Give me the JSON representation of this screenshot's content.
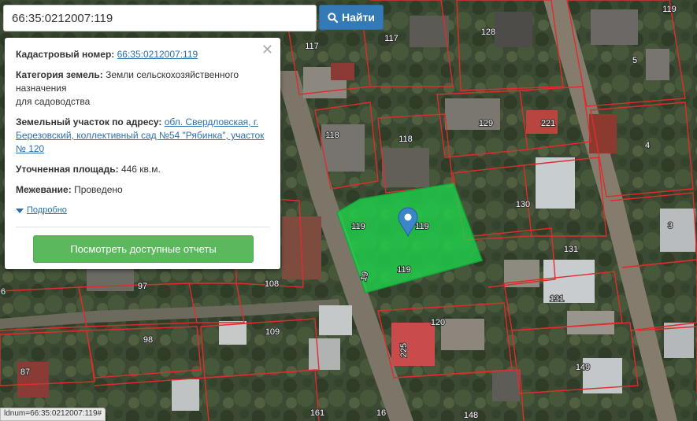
{
  "search": {
    "value": "66:35:0212007:119",
    "button_label": "Найти"
  },
  "popup": {
    "cadastral_label": "Кадастровый номер:",
    "cadastral_value": "66:35:0212007:119",
    "category_label": "Категория земель:",
    "category_value": "Земли сельскохозяйственного назначения",
    "category_use": "для садоводства",
    "address_label": "Земельный участок по адресу:",
    "address_value": "обл. Свердловская, г. Березовский, коллективный сад №54 \"Рябинка\", участок № 120",
    "area_label": "Уточненная площадь:",
    "area_value": "446 кв.м.",
    "survey_label": "Межевание:",
    "survey_value": "Проведено",
    "details_label": "Подробно",
    "report_button": "Посмотреть доступные отчеты"
  },
  "map": {
    "parcel_labels": [
      "128",
      "117",
      "117",
      "119",
      "5",
      "129",
      "221",
      "118",
      "118",
      "4",
      "119",
      "119",
      "19",
      "130",
      "3",
      "131",
      "131",
      "119",
      "97",
      "108",
      "6",
      "120",
      "225",
      "109",
      "98",
      "87",
      "149",
      "161",
      "16",
      "148"
    ],
    "highlight_color": "#1fd04a",
    "marker_color": "#3a86c8"
  },
  "status_text": "ldnum=66:35:0212007:119#"
}
